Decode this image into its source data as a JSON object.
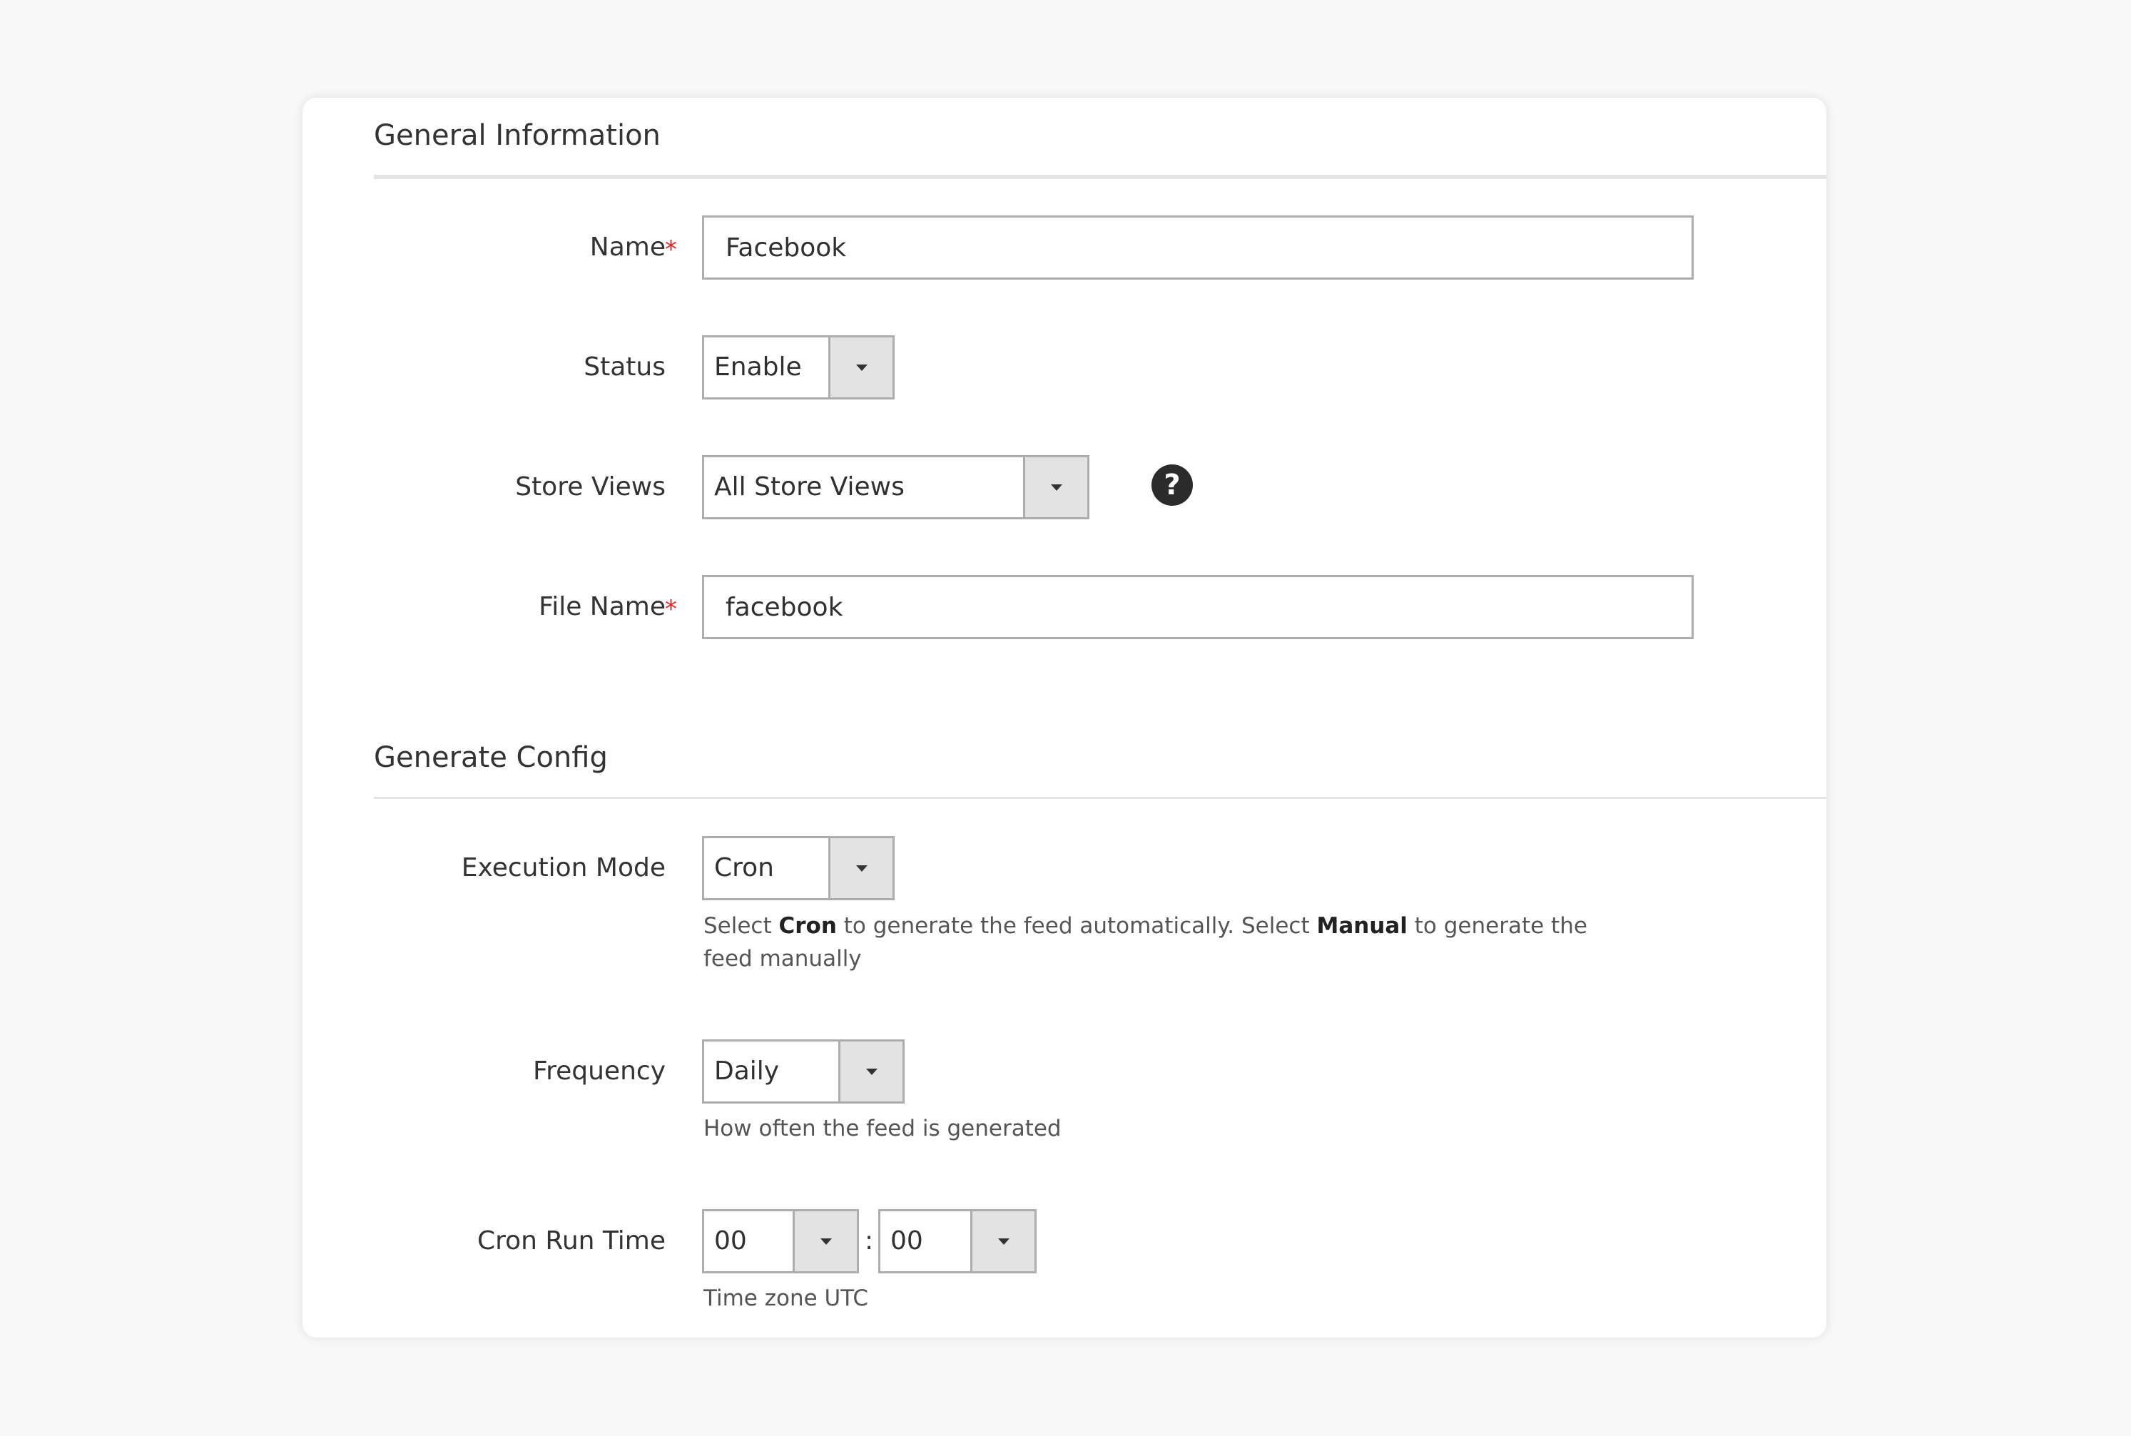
{
  "general": {
    "title": "General Information",
    "name": {
      "label": "Name",
      "required_mark": "*",
      "value": "Facebook"
    },
    "status": {
      "label": "Status",
      "value": "Enable"
    },
    "store_views": {
      "label": "Store Views",
      "value": "All Store Views",
      "help_icon": "?"
    },
    "file_name": {
      "label": "File Name",
      "required_mark": "*",
      "value": "facebook"
    }
  },
  "generate": {
    "title": "Generate Config",
    "execution_mode": {
      "label": "Execution Mode",
      "value": "Cron",
      "note_1": "Select ",
      "note_bold_1": "Cron",
      "note_2": " to generate the feed automatically. Select ",
      "note_bold_2": "Manual",
      "note_3": " to generate the feed manually"
    },
    "frequency": {
      "label": "Frequency",
      "value": "Daily",
      "note": "How often the feed is generated"
    },
    "cron_run_time": {
      "label": "Cron Run Time",
      "hour": "00",
      "separator": ":",
      "minute": "00",
      "note": "Time zone UTC"
    }
  },
  "colors": {
    "required": "#e22626",
    "border": "#adadad",
    "button_bg": "#e3e3e3",
    "help_icon_bg": "#2b2b2b"
  }
}
